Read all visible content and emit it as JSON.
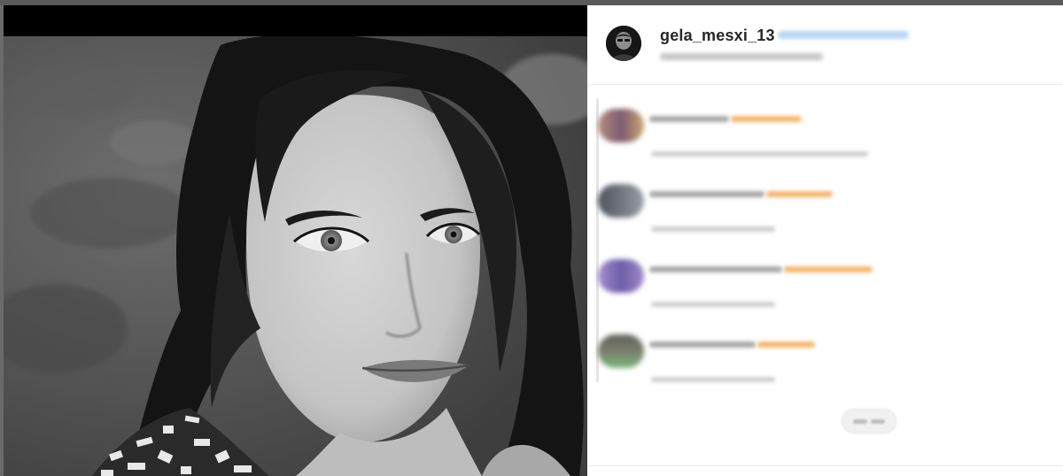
{
  "post": {
    "username": "gela_mesxi_13"
  },
  "colors": {
    "link_accent": "#b9d6f3",
    "tag_accent": "#f5b76e",
    "media_background": "#000000"
  },
  "icons": {
    "profile_avatar": "avatar",
    "load_more": "load-more-icon"
  }
}
